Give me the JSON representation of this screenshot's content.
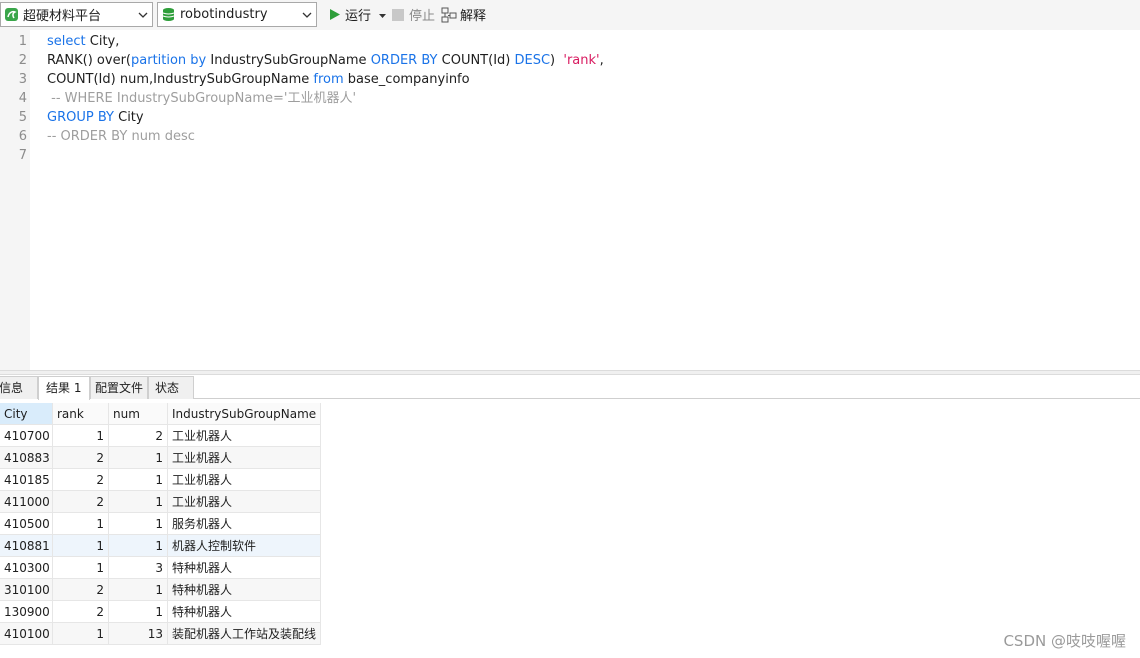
{
  "toolbar": {
    "connection": "超硬材料平台",
    "database": "robotindustry",
    "run_label": "运行",
    "stop_label": "停止",
    "explain_label": "解释",
    "colors": {
      "run": "#2e9e3a",
      "db_icon": "#2e9e3a",
      "conn_icon": "#3aa64a"
    }
  },
  "editor": {
    "line_numbers": [
      "1",
      "2",
      "3",
      "4",
      "5",
      "6",
      "7"
    ],
    "lines": [
      [
        {
          "t": "kw",
          "v": "select"
        },
        {
          "t": "plain",
          "v": " City,"
        }
      ],
      [
        {
          "t": "plain",
          "v": "RANK() over("
        },
        {
          "t": "kw",
          "v": "partition by"
        },
        {
          "t": "plain",
          "v": " IndustrySubGroupName "
        },
        {
          "t": "kw",
          "v": "ORDER BY"
        },
        {
          "t": "plain",
          "v": " COUNT(Id) "
        },
        {
          "t": "kw",
          "v": "DESC"
        },
        {
          "t": "plain",
          "v": ")  "
        },
        {
          "t": "str",
          "v": "'rank'"
        },
        {
          "t": "plain",
          "v": ","
        }
      ],
      [
        {
          "t": "plain",
          "v": "COUNT(Id) num,IndustrySubGroupName "
        },
        {
          "t": "kw",
          "v": "from"
        },
        {
          "t": "plain",
          "v": " base_companyinfo"
        }
      ],
      [
        {
          "t": "cmt",
          "v": " -- WHERE IndustrySubGroupName='工业机器人'"
        }
      ],
      [
        {
          "t": "kw",
          "v": "GROUP BY"
        },
        {
          "t": "plain",
          "v": " City"
        }
      ],
      [
        {
          "t": "cmt",
          "v": "-- ORDER BY num desc"
        }
      ],
      []
    ]
  },
  "tabs": [
    "信息",
    "结果 1",
    "配置文件",
    "状态"
  ],
  "active_tab": "结果 1",
  "result": {
    "columns": [
      "City",
      "rank",
      "num",
      "IndustrySubGroupName"
    ],
    "rows": [
      [
        "410700",
        "1",
        "2",
        "工业机器人"
      ],
      [
        "410883",
        "2",
        "1",
        "工业机器人"
      ],
      [
        "410185",
        "2",
        "1",
        "工业机器人"
      ],
      [
        "411000",
        "2",
        "1",
        "工业机器人"
      ],
      [
        "410500",
        "1",
        "1",
        "服务机器人"
      ],
      [
        "410881",
        "1",
        "1",
        "机器人控制软件"
      ],
      [
        "410300",
        "1",
        "3",
        "特种机器人"
      ],
      [
        "310100",
        "2",
        "1",
        "特种机器人"
      ],
      [
        "130900",
        "2",
        "1",
        "特种机器人"
      ],
      [
        "410100",
        "1",
        "13",
        "装配机器人工作站及装配线"
      ]
    ]
  },
  "watermark": "CSDN @吱吱喔喔"
}
